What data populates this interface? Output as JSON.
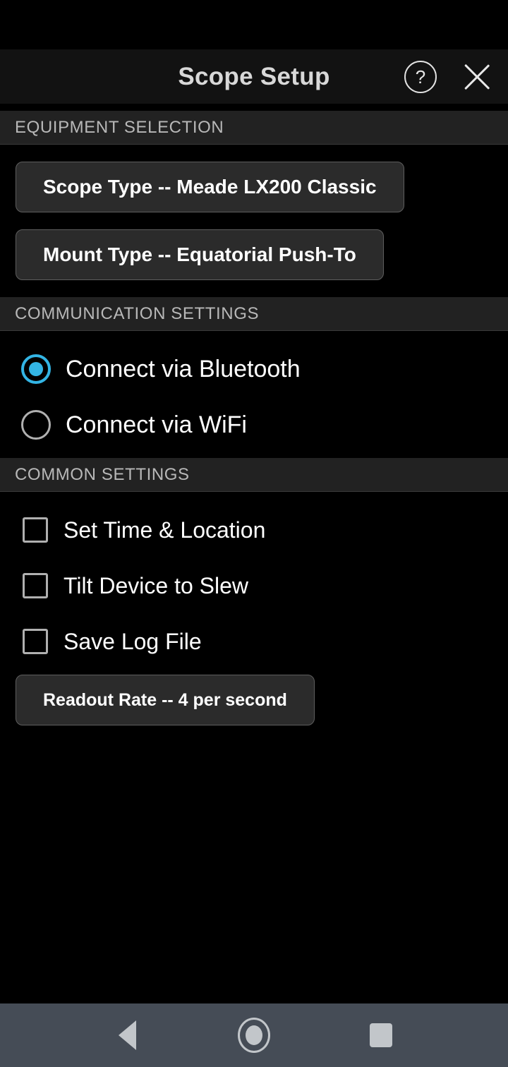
{
  "header": {
    "title": "Scope Setup",
    "help_icon": "help-circle-icon",
    "help_glyph": "?",
    "close_icon": "close-x-icon"
  },
  "sections": {
    "equipment": {
      "label": "EQUIPMENT SELECTION",
      "buttons": [
        {
          "name": "scope-type-button",
          "label": "Scope Type -- Meade LX200 Classic"
        },
        {
          "name": "mount-type-button",
          "label": "Mount Type -- Equatorial Push-To"
        }
      ]
    },
    "communication": {
      "label": "COMMUNICATION SETTINGS",
      "options": [
        {
          "name": "connect-bluetooth-radio",
          "label": "Connect via Bluetooth",
          "selected": true
        },
        {
          "name": "connect-wifi-radio",
          "label": "Connect via WiFi",
          "selected": false
        }
      ]
    },
    "common": {
      "label": "COMMON SETTINGS",
      "checkboxes": [
        {
          "name": "set-time-location-checkbox",
          "label": "Set Time & Location",
          "checked": false
        },
        {
          "name": "tilt-device-to-slew-checkbox",
          "label": "Tilt Device to Slew",
          "checked": false
        },
        {
          "name": "save-log-file-checkbox",
          "label": "Save Log File",
          "checked": false
        }
      ],
      "readout_button": {
        "name": "readout-rate-button",
        "label": "Readout Rate -- 4 per second"
      }
    }
  },
  "navbar": {
    "back": "back-triangle-icon",
    "home": "home-circle-icon",
    "recents": "recents-square-icon"
  },
  "colors": {
    "accent": "#33b5e5",
    "background": "#000000",
    "title_bar": "#121212",
    "section_bar": "#222222",
    "button_fill": "#2b2b2b",
    "button_border": "#5e5e5e",
    "navbar": "#454c56"
  }
}
